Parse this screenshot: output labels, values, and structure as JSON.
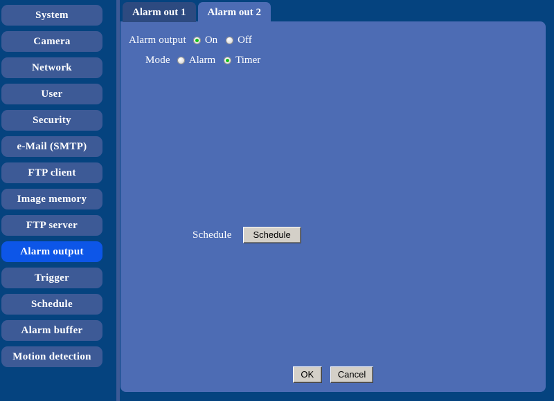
{
  "theme": {
    "background": "#05437f",
    "panel_bg": "#4d6cb4",
    "sidebar_item_bg": "#3d5a96",
    "sidebar_item_active_bg": "#0d56e8",
    "tab_inactive_bg": "#2d4a80",
    "tab_active_bg": "#4d6cb4",
    "radio_selected_color": "#15c215",
    "button_face": "#d4d0c8",
    "text_color": "#ffffff"
  },
  "sidebar": {
    "items": [
      {
        "label": "System",
        "active": false
      },
      {
        "label": "Camera",
        "active": false
      },
      {
        "label": "Network",
        "active": false
      },
      {
        "label": "User",
        "active": false
      },
      {
        "label": "Security",
        "active": false
      },
      {
        "label": "e-Mail (SMTP)",
        "active": false
      },
      {
        "label": "FTP client",
        "active": false
      },
      {
        "label": "Image memory",
        "active": false
      },
      {
        "label": "FTP server",
        "active": false
      },
      {
        "label": "Alarm output",
        "active": true
      },
      {
        "label": "Trigger",
        "active": false
      },
      {
        "label": "Schedule",
        "active": false
      },
      {
        "label": "Alarm buffer",
        "active": false
      },
      {
        "label": "Motion detection",
        "active": false
      }
    ]
  },
  "tabs": [
    {
      "label": "Alarm out 1",
      "active": false
    },
    {
      "label": "Alarm out 2",
      "active": true
    }
  ],
  "form": {
    "alarm_output": {
      "label": "Alarm output",
      "options": [
        {
          "label": "On",
          "selected": true
        },
        {
          "label": "Off",
          "selected": false
        }
      ]
    },
    "mode": {
      "label": "Mode",
      "options": [
        {
          "label": "Alarm",
          "selected": false
        },
        {
          "label": "Timer",
          "selected": true
        }
      ]
    },
    "schedule": {
      "label": "Schedule",
      "button_label": "Schedule"
    }
  },
  "footer": {
    "ok_label": "OK",
    "cancel_label": "Cancel"
  }
}
